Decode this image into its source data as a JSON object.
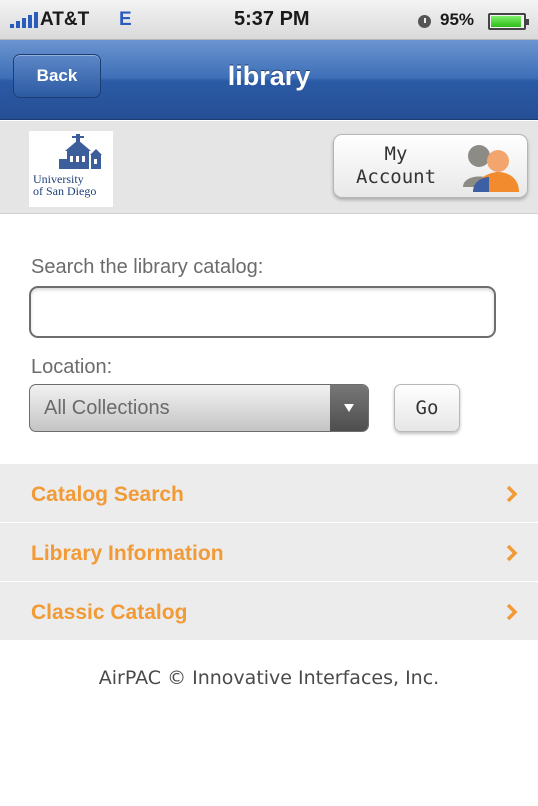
{
  "status_bar": {
    "carrier": "AT&T",
    "network": "E",
    "time": "5:37 PM",
    "battery": "95%",
    "battery_level": 0.95,
    "alarm_icon": "alarm-icon"
  },
  "nav": {
    "back_label": "Back",
    "title": "library"
  },
  "header": {
    "logo_text_line1": "University",
    "logo_text_line2": "of San Diego",
    "account_line1": "My",
    "account_line2": "Account",
    "account_icon": "users-icon"
  },
  "search": {
    "label": "Search the library catalog:",
    "value": "",
    "placeholder": ""
  },
  "location": {
    "label": "Location:",
    "selected": "All Collections",
    "go_label": "Go"
  },
  "menu": {
    "items": [
      {
        "label": "Catalog Search"
      },
      {
        "label": "Library Information"
      },
      {
        "label": "Classic Catalog"
      }
    ]
  },
  "footer": {
    "text": "AirPAC © Innovative Interfaces, Inc."
  },
  "colors": {
    "nav_blue": "#2b5aa5",
    "menu_orange": "#f29a35",
    "menu_bg": "#ececec"
  }
}
